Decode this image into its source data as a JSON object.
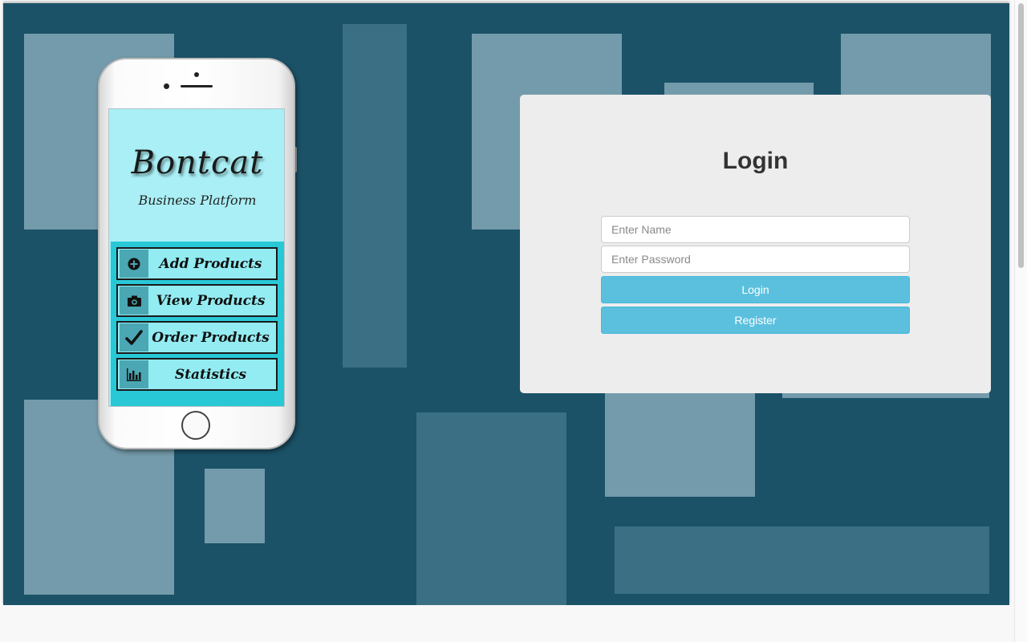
{
  "colors": {
    "hero_background": "#1b5268",
    "card_background": "#ededed",
    "button_info": "#5bc0de",
    "phone_screen": "#a9eff5",
    "phone_menu_panel": "#29c8d7"
  },
  "phone": {
    "brand_name": "Bontcat",
    "tagline": "Business Platform",
    "menu": [
      {
        "label": "Add Products",
        "icon": "plus-circle-icon"
      },
      {
        "label": "View Products",
        "icon": "camera-icon"
      },
      {
        "label": "Order Products",
        "icon": "checkmark-icon"
      },
      {
        "label": "Statistics",
        "icon": "bar-chart-icon"
      }
    ]
  },
  "login": {
    "title": "Login",
    "name_placeholder": "Enter Name",
    "password_placeholder": "Enter Password",
    "login_button": "Login",
    "register_button": "Register"
  }
}
